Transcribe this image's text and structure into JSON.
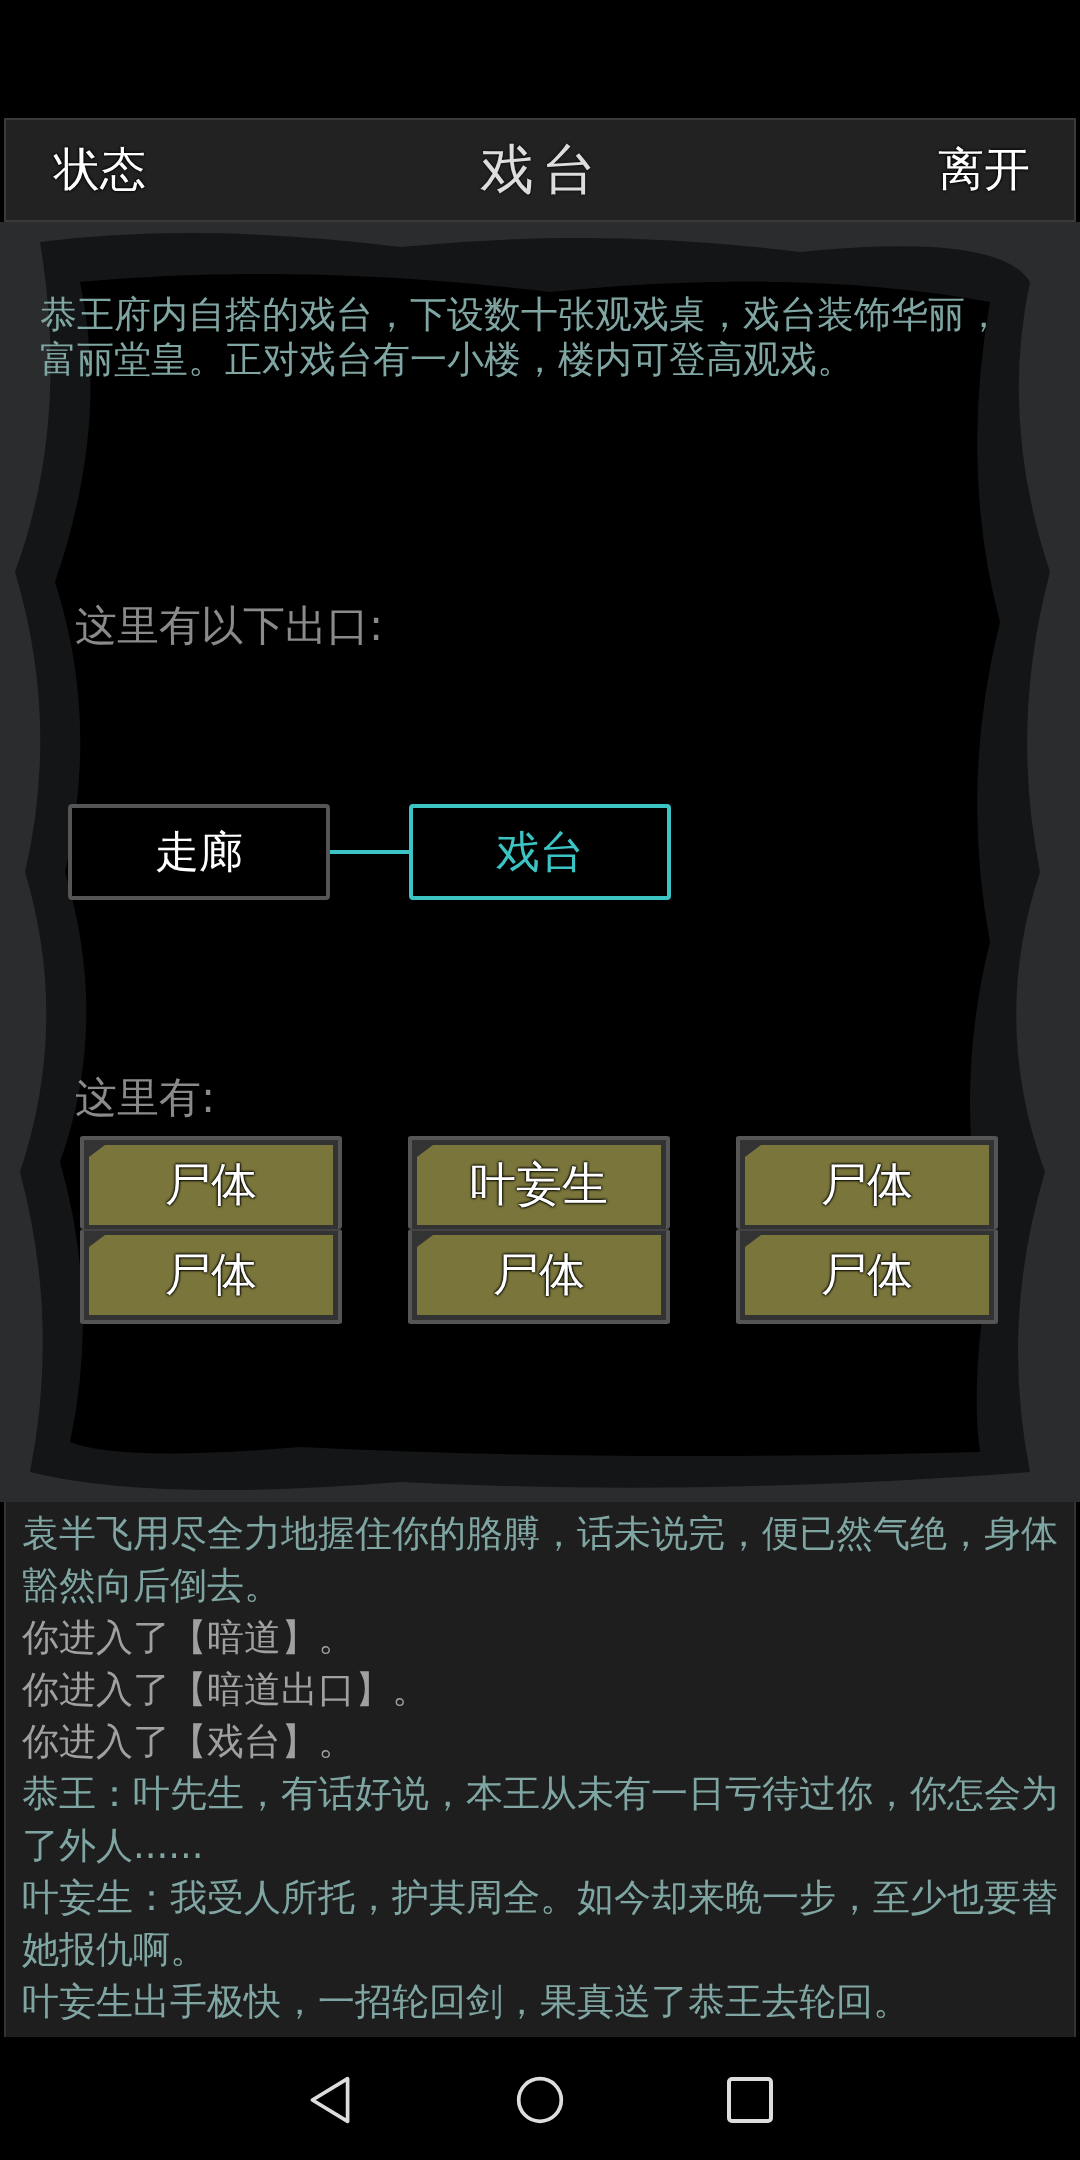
{
  "header": {
    "left": "状态",
    "title": "戏台",
    "right": "离开"
  },
  "description": "恭王府内自搭的戏台，下设数十张观戏桌，戏台装饰华丽，富丽堂皇。正对戏台有一小楼，楼内可登高观戏。",
  "exits_label": "这里有以下出口:",
  "exits": [
    {
      "label": "走廊",
      "selected": false
    },
    {
      "label": "戏台",
      "selected": true
    }
  ],
  "here_label": "这里有:",
  "entities": [
    {
      "label": "尸体"
    },
    {
      "label": "叶妄生"
    },
    {
      "label": "尸体"
    },
    {
      "label": "尸体"
    },
    {
      "label": "尸体"
    },
    {
      "label": "尸体"
    }
  ],
  "log": [
    {
      "kind": "narration",
      "text": "袁半飞用尽全力地握住你的胳膊，话未说完，便已然气绝，身体豁然向后倒去。"
    },
    {
      "kind": "system",
      "text": "你进入了【暗道】。"
    },
    {
      "kind": "system",
      "text": "你进入了【暗道出口】。"
    },
    {
      "kind": "system",
      "text": "你进入了【戏台】。"
    },
    {
      "kind": "narration",
      "text": "恭王：叶先生，有话好说，本王从未有一日亏待过你，你怎会为了外人......"
    },
    {
      "kind": "narration",
      "text": "叶妄生：我受人所托，护其周全。如今却来晚一步，至少也要替她报仇啊。"
    },
    {
      "kind": "narration",
      "text": "叶妄生出手极快，一招轮回剑，果真送了恭王去轮回。"
    }
  ]
}
